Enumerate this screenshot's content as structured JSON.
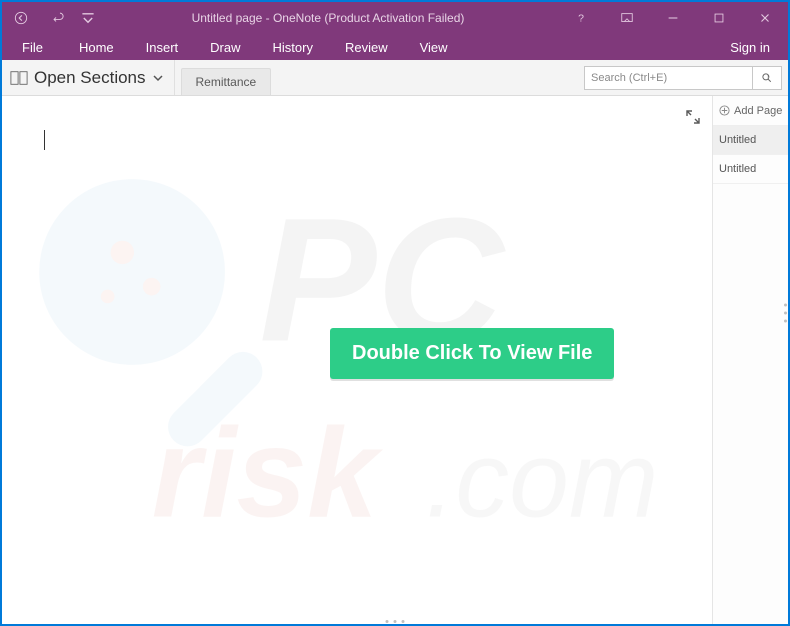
{
  "titlebar": {
    "title": "Untitled page - OneNote (Product Activation Failed)"
  },
  "menu": {
    "file": "File",
    "items": [
      "Home",
      "Insert",
      "Draw",
      "History",
      "Review",
      "View"
    ],
    "signin": "Sign in"
  },
  "sectionbar": {
    "notebook_label": "Open Sections",
    "tab_label": "Remittance",
    "search_placeholder": "Search (Ctrl+E)"
  },
  "pagepane": {
    "add_page_label": "Add Page",
    "pages": [
      "Untitled",
      "Untitled"
    ]
  },
  "cta": {
    "label": "Double Click To View File"
  },
  "icons": {
    "back": "back-icon",
    "undo": "undo-icon",
    "qat_chevron": "chevron-down-icon",
    "help": "help-icon",
    "ribbon_display": "ribbon-display-icon",
    "minimize": "minimize-icon",
    "maximize": "maximize-icon",
    "close": "close-icon",
    "notebook": "notebook-icon",
    "search": "search-icon",
    "expand": "expand-icon",
    "add": "plus-icon"
  }
}
